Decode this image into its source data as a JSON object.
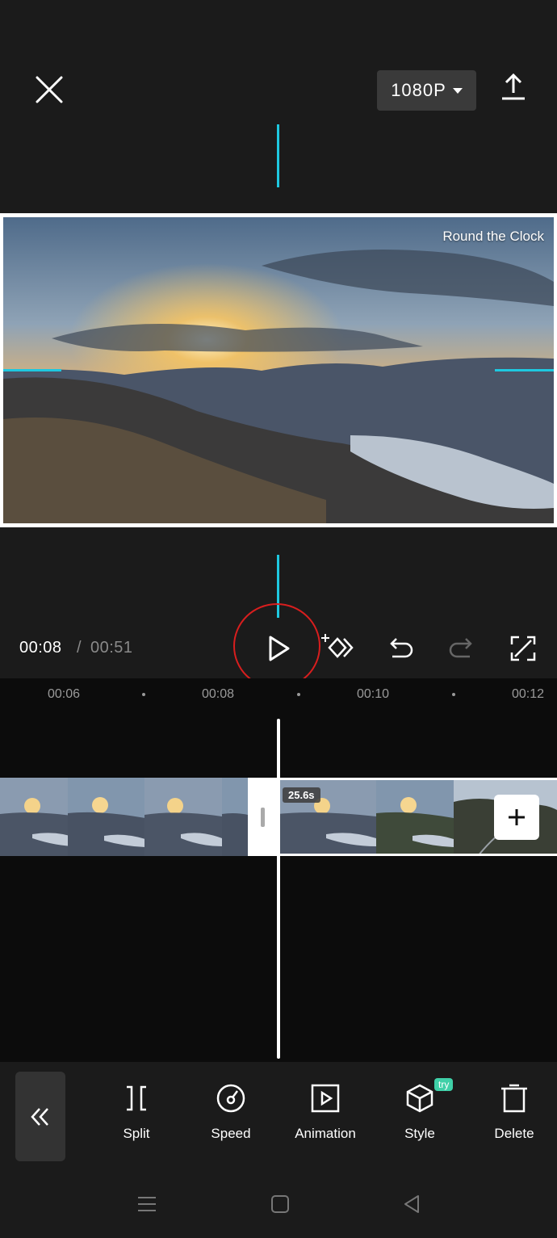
{
  "topbar": {
    "resolution_label": "1080P",
    "close_icon": "close-icon",
    "export_icon": "upload-icon"
  },
  "preview": {
    "watermark_text": "Round the Clock"
  },
  "playback": {
    "current_time": "00:08",
    "separator": "/",
    "total_time": "00:51"
  },
  "ruler": {
    "labels": [
      "00:06",
      "00:08",
      "00:10",
      "00:12"
    ]
  },
  "timeline": {
    "clip_duration": "25.6s",
    "add_label": "+"
  },
  "toolbar": {
    "items": [
      {
        "label": "Split",
        "icon": "split-icon"
      },
      {
        "label": "Speed",
        "icon": "speed-icon"
      },
      {
        "label": "Animation",
        "icon": "animation-icon"
      },
      {
        "label": "Style",
        "icon": "cube-icon",
        "badge": "try"
      },
      {
        "label": "Delete",
        "icon": "trash-icon"
      }
    ]
  },
  "colors": {
    "accent": "#1ec8e0",
    "highlight": "#d81e1e",
    "try_badge": "#3fd0a8"
  }
}
